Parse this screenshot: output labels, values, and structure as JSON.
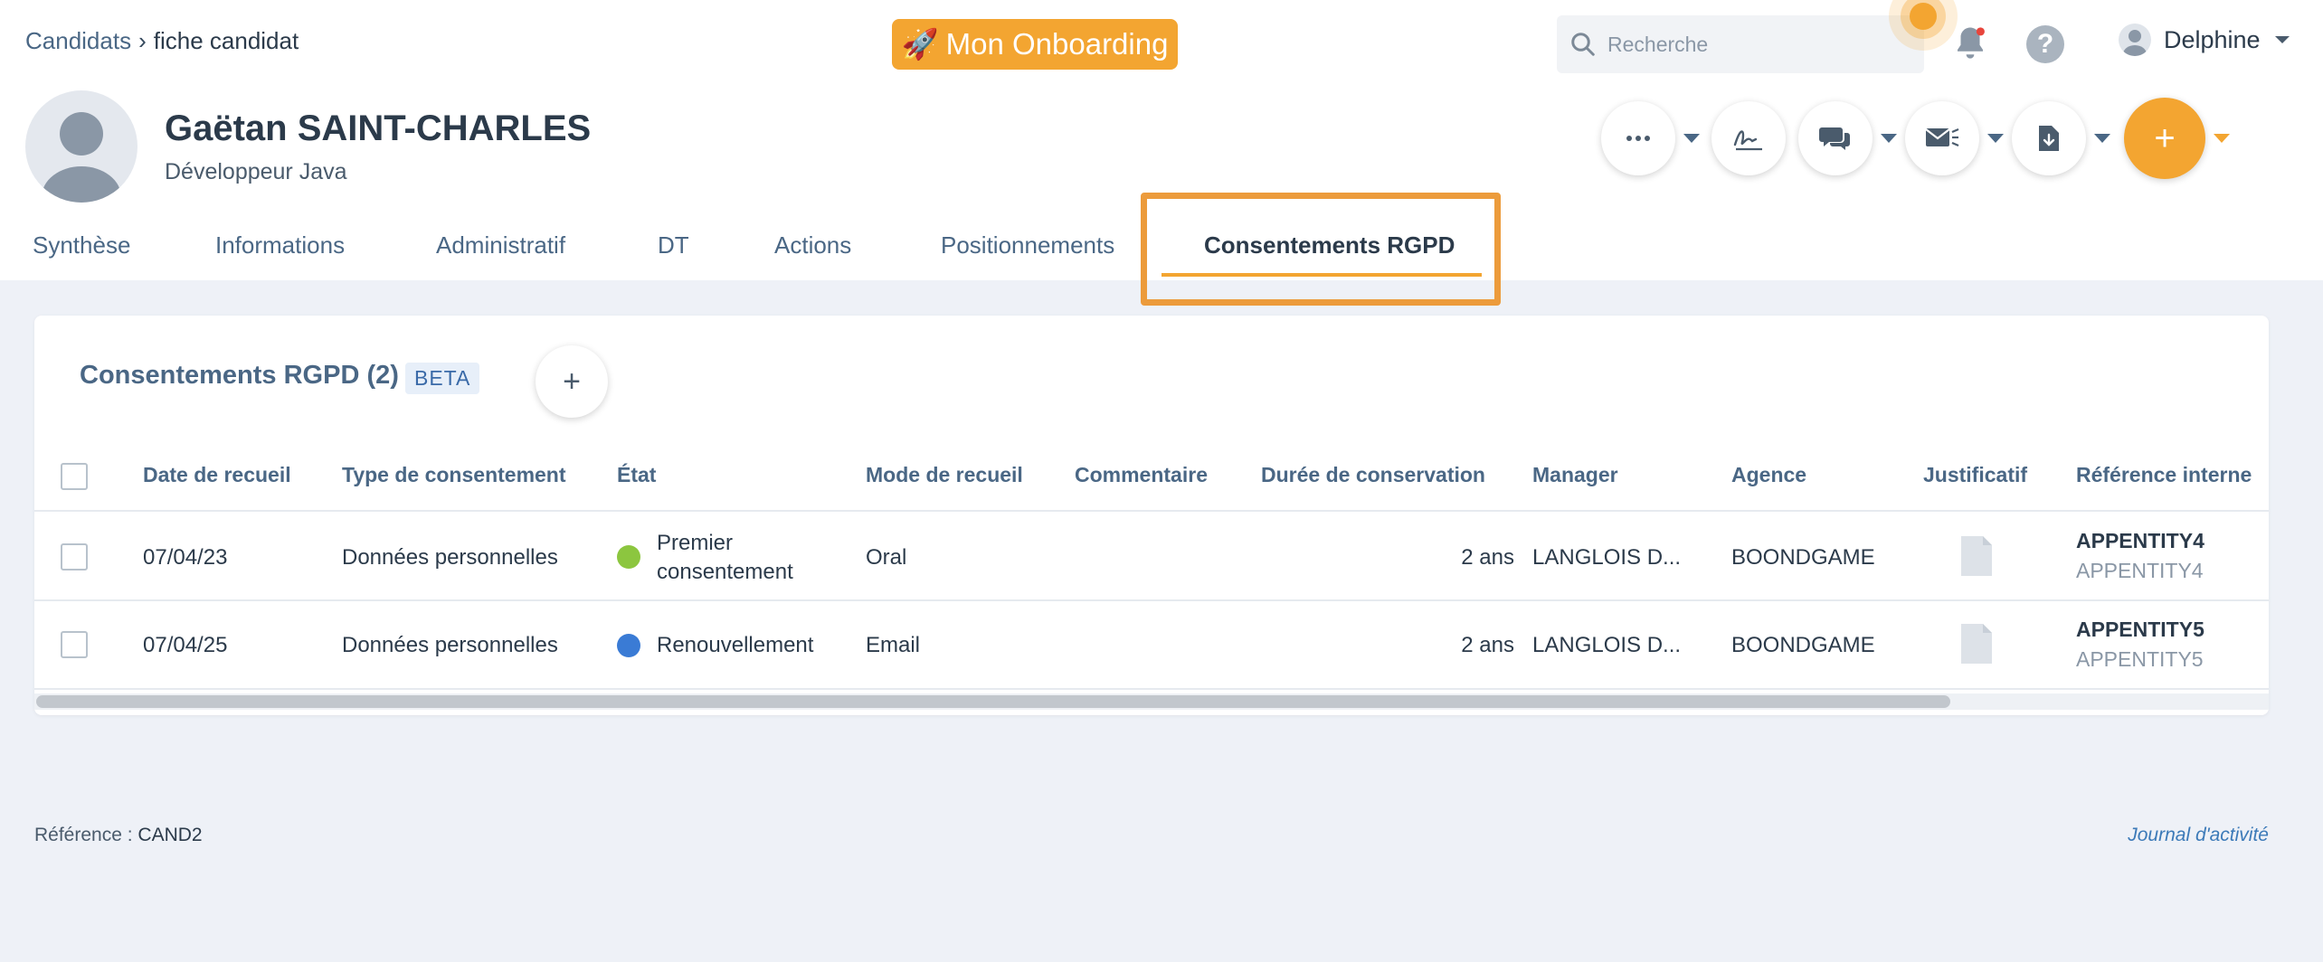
{
  "breadcrumb": {
    "parent": "Candidats",
    "current": "fiche candidat"
  },
  "onboarding": {
    "label": "Mon Onboarding",
    "icon": "🚀"
  },
  "search": {
    "placeholder": "Recherche"
  },
  "user": {
    "name": "Delphine"
  },
  "profile": {
    "name": "Gaëtan SAINT-CHARLES",
    "job": "Développeur Java"
  },
  "actions": [
    {
      "name": "more-actions",
      "symbol": "•••"
    },
    {
      "name": "signature",
      "symbol": "✍"
    },
    {
      "name": "chat",
      "symbol": "💬"
    },
    {
      "name": "email",
      "symbol": "✉"
    },
    {
      "name": "document",
      "symbol": "📄"
    }
  ],
  "tabs": [
    {
      "label": "Synthèse"
    },
    {
      "label": "Informations"
    },
    {
      "label": "Administratif"
    },
    {
      "label": "DT"
    },
    {
      "label": "Actions"
    },
    {
      "label": "Positionnements"
    },
    {
      "label": "Consentements RGPD"
    }
  ],
  "section": {
    "title": "Consentements RGPD (2)",
    "badge": "BETA"
  },
  "table": {
    "headers": [
      "Date de recueil",
      "Type de consentement",
      "État",
      "Mode de recueil",
      "Commentaire",
      "Durée de conservation",
      "Manager",
      "Agence",
      "Justificatif",
      "Référence interne"
    ],
    "rows": [
      {
        "date": "07/04/23",
        "type": "Données personnelles",
        "etat_line1": "Premier",
        "etat_line2": "consentement",
        "etat_color": "#8cc63f",
        "mode": "Oral",
        "commentaire": "",
        "duree": "2 ans",
        "manager": "LANGLOIS D...",
        "agence": "BOONDGAME",
        "ref_main": "APPENTITY4",
        "ref_sub": "APPENTITY4"
      },
      {
        "date": "07/04/25",
        "type": "Données personnelles",
        "etat_line1": "Renouvellement",
        "etat_line2": "",
        "etat_color": "#3a7bd5",
        "mode": "Email",
        "commentaire": "",
        "duree": "2 ans",
        "manager": "LANGLOIS D...",
        "agence": "BOONDGAME",
        "ref_main": "APPENTITY5",
        "ref_sub": "APPENTITY5"
      }
    ]
  },
  "footer": {
    "ref_label": "Référence :",
    "ref_value": "CAND2",
    "journal": "Journal d'activité"
  }
}
